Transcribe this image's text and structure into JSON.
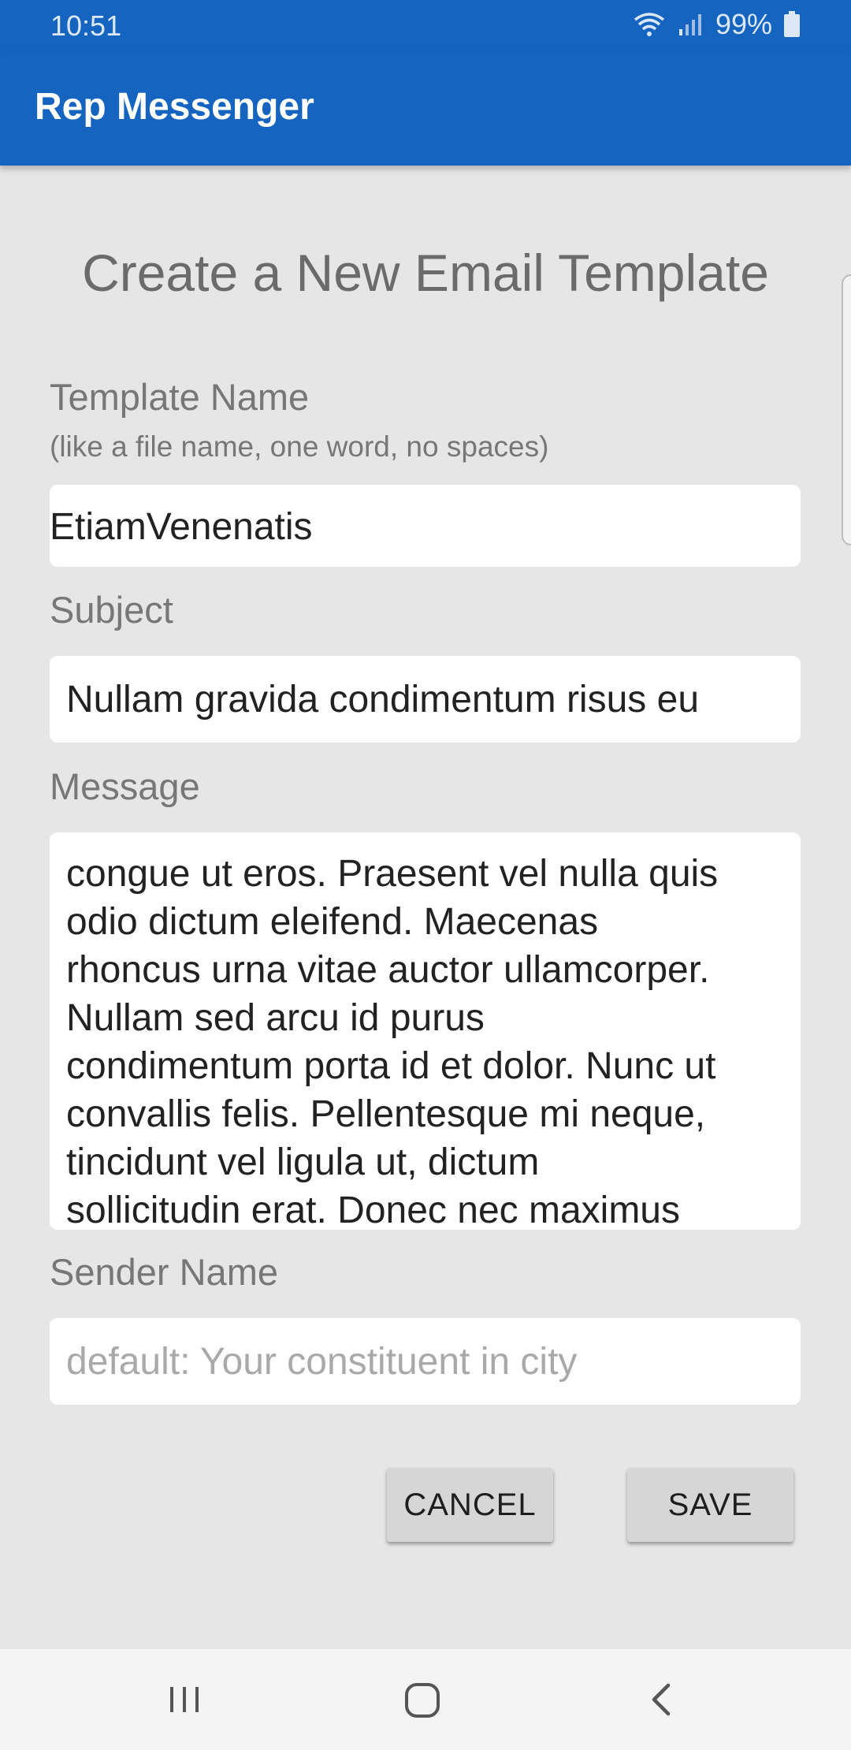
{
  "status_bar": {
    "time": "10:51",
    "battery": "99%"
  },
  "app_bar": {
    "title": "Rep Messenger"
  },
  "form": {
    "heading": "Create a New Email Template",
    "template_name": {
      "label": "Template Name",
      "hint": "(like a file name, one word, no spaces)",
      "value": "EtiamVenenatis"
    },
    "subject": {
      "label": "Subject",
      "value": "Nullam gravida condimentum risus eu"
    },
    "message": {
      "label": "Message",
      "value": "congue ut eros. Praesent vel nulla quis\nodio dictum eleifend. Maecenas\nrhoncus urna vitae auctor ullamcorper.\nNullam sed arcu id purus\ncondimentum porta id et dolor. Nunc ut\nconvallis felis. Pellentesque mi neque,\ntincidunt vel ligula ut, dictum\nsollicitudin erat. Donec nec maximus"
    },
    "sender_name": {
      "label": "Sender Name",
      "placeholder": "default: Your constituent in city"
    },
    "buttons": {
      "cancel": "CANCEL",
      "save": "SAVE"
    }
  },
  "colors": {
    "app_bar": "#1565c0",
    "background": "#e6e6e6",
    "button": "#d6d6d6"
  }
}
